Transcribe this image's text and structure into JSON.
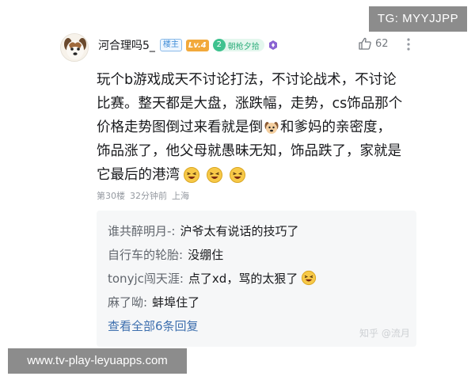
{
  "overlays": {
    "tg_badge": "TG: MYYJJPP",
    "bottom_url": "www.tv-play-leyuapps.com",
    "watermark": "知乎 @流月"
  },
  "comment": {
    "username": "河合理吗5_",
    "badge_owner": "楼主",
    "badge_level": "Lv.4",
    "fan_badge_num": "2",
    "fan_badge_text": "朝枪夕拾",
    "like_count": "62",
    "lines": [
      "玩个b游戏成天不讨论打法，不讨论战术，不讨论",
      "比赛。整天都是大盘，涨跌幅，走势，cs饰品那个",
      "价格走势图倒过来看就是倒",
      "和爹妈的亲密度，",
      "饰品涨了，他父母就愚昧无知，饰品跌了，家就是",
      "它最后的港湾"
    ],
    "floor": "第30楼",
    "time": "32分钟前",
    "location": "上海"
  },
  "replies": [
    {
      "name": "谁共醉明月-:",
      "text": "沪爷太有说话的技巧了"
    },
    {
      "name": "自行车的轮胎:",
      "text": "没绷住"
    },
    {
      "name": "tonyjc闯天涯:",
      "text": "点了xd，骂的太狠了"
    },
    {
      "name": "麻了呦:",
      "text": "蚌埠住了"
    }
  ],
  "view_all": "查看全部6条回复",
  "colors": {
    "accent_link": "#3d6fae",
    "level_badge": "#f2a93b",
    "fan_badge": "#3ec28f",
    "reply_bg": "#f6f7f8"
  },
  "icons": [
    "dog-avatar",
    "thumb-up-icon",
    "more-vert-icon",
    "dog-emoji",
    "laughing-emoji",
    "purple-badge-icon"
  ]
}
